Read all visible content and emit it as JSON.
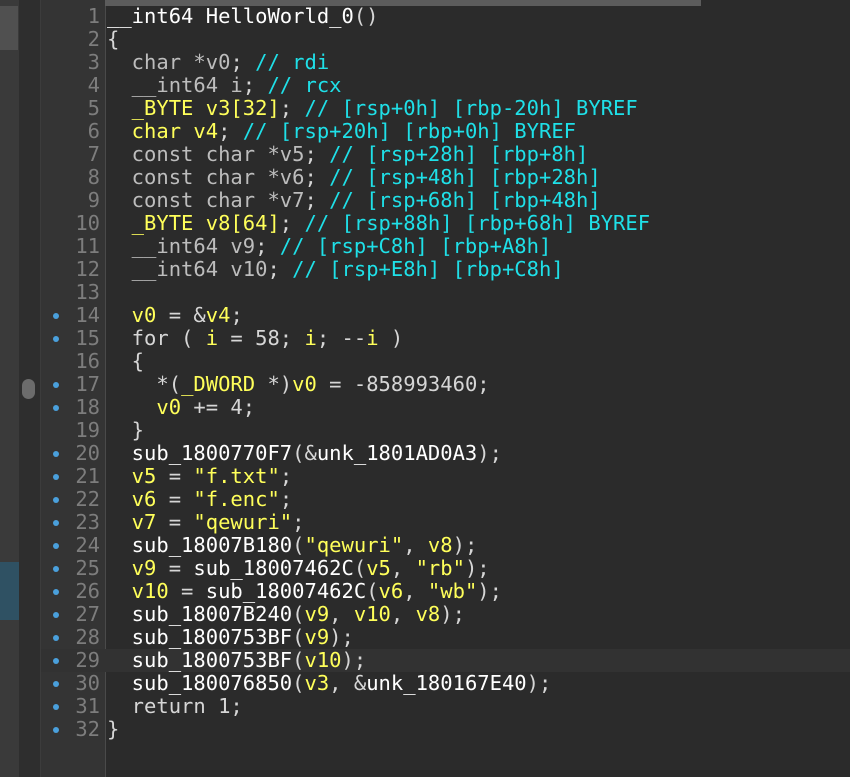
{
  "editor": {
    "lines": [
      {
        "n": "1",
        "dot": false,
        "parts": [
          [
            "__int64 HelloWorld_0",
            "t-fn"
          ],
          [
            "()",
            "t-kw"
          ]
        ]
      },
      {
        "n": "2",
        "dot": false,
        "parts": [
          [
            "{",
            "t-kw"
          ]
        ]
      },
      {
        "n": "3",
        "dot": false,
        "parts": [
          [
            "  char *",
            "t-gray"
          ],
          [
            "v0",
            "t-gray"
          ],
          [
            "; ",
            "t-kw"
          ],
          [
            "// rdi",
            "t-cmt"
          ]
        ]
      },
      {
        "n": "4",
        "dot": false,
        "parts": [
          [
            "  __int64 ",
            "t-gray"
          ],
          [
            "i",
            "t-gray"
          ],
          [
            "; ",
            "t-kw"
          ],
          [
            "// rcx",
            "t-cmt"
          ]
        ]
      },
      {
        "n": "5",
        "dot": false,
        "parts": [
          [
            "  _BYTE v3[32]",
            "t-var"
          ],
          [
            "; ",
            "t-kw"
          ],
          [
            "// [rsp+0h] [rbp-20h] BYREF",
            "t-cmt"
          ]
        ]
      },
      {
        "n": "6",
        "dot": false,
        "parts": [
          [
            "  char v4",
            "t-var"
          ],
          [
            "; ",
            "t-kw"
          ],
          [
            "// [rsp+20h] [rbp+0h] BYREF",
            "t-cmt"
          ]
        ]
      },
      {
        "n": "7",
        "dot": false,
        "parts": [
          [
            "  const char *v5",
            "t-gray"
          ],
          [
            "; ",
            "t-kw"
          ],
          [
            "// [rsp+28h] [rbp+8h]",
            "t-cmt"
          ]
        ]
      },
      {
        "n": "8",
        "dot": false,
        "parts": [
          [
            "  const char *v6",
            "t-gray"
          ],
          [
            "; ",
            "t-kw"
          ],
          [
            "// [rsp+48h] [rbp+28h]",
            "t-cmt"
          ]
        ]
      },
      {
        "n": "9",
        "dot": false,
        "parts": [
          [
            "  const char *v7",
            "t-gray"
          ],
          [
            "; ",
            "t-kw"
          ],
          [
            "// [rsp+68h] [rbp+48h]",
            "t-cmt"
          ]
        ]
      },
      {
        "n": "10",
        "dot": false,
        "parts": [
          [
            "  _BYTE v8[64]",
            "t-var"
          ],
          [
            "; ",
            "t-kw"
          ],
          [
            "// [rsp+88h] [rbp+68h] BYREF",
            "t-cmt"
          ]
        ]
      },
      {
        "n": "11",
        "dot": false,
        "parts": [
          [
            "  __int64 v9",
            "t-gray"
          ],
          [
            "; ",
            "t-kw"
          ],
          [
            "// [rsp+C8h] [rbp+A8h]",
            "t-cmt"
          ]
        ]
      },
      {
        "n": "12",
        "dot": false,
        "parts": [
          [
            "  __int64 v10",
            "t-gray"
          ],
          [
            "; ",
            "t-kw"
          ],
          [
            "// [rsp+E8h] [rbp+C8h]",
            "t-cmt"
          ]
        ]
      },
      {
        "n": "13",
        "dot": false,
        "parts": []
      },
      {
        "n": "14",
        "dot": true,
        "parts": [
          [
            "  v0",
            "t-var"
          ],
          [
            " = &",
            "t-kw"
          ],
          [
            "v4",
            "t-var"
          ],
          [
            ";",
            "t-kw"
          ]
        ]
      },
      {
        "n": "15",
        "dot": true,
        "parts": [
          [
            "  for ( ",
            "t-kw"
          ],
          [
            "i",
            "t-var"
          ],
          [
            " = 58; ",
            "t-kw"
          ],
          [
            "i",
            "t-var"
          ],
          [
            "; --",
            "t-kw"
          ],
          [
            "i",
            "t-var"
          ],
          [
            " )",
            "t-kw"
          ]
        ]
      },
      {
        "n": "16",
        "dot": false,
        "parts": [
          [
            "  {",
            "t-kw"
          ]
        ]
      },
      {
        "n": "17",
        "dot": true,
        "parts": [
          [
            "    *(",
            "t-kw"
          ],
          [
            "_DWORD",
            "t-var"
          ],
          [
            " *)",
            "t-kw"
          ],
          [
            "v0",
            "t-var"
          ],
          [
            " = -858993460;",
            "t-kw"
          ]
        ]
      },
      {
        "n": "18",
        "dot": true,
        "parts": [
          [
            "    v0",
            "t-var"
          ],
          [
            " += 4;",
            "t-kw"
          ]
        ]
      },
      {
        "n": "19",
        "dot": false,
        "parts": [
          [
            "  }",
            "t-kw"
          ]
        ]
      },
      {
        "n": "20",
        "dot": true,
        "parts": [
          [
            "  sub_1800770F7",
            "t-fn"
          ],
          [
            "(&",
            "t-kw"
          ],
          [
            "unk_1801AD0A3",
            "t-fn"
          ],
          [
            ");",
            "t-kw"
          ]
        ]
      },
      {
        "n": "21",
        "dot": true,
        "parts": [
          [
            "  v5",
            "t-var"
          ],
          [
            " = ",
            "t-kw"
          ],
          [
            "\"f.txt\"",
            "t-str"
          ],
          [
            ";",
            "t-kw"
          ]
        ]
      },
      {
        "n": "22",
        "dot": true,
        "parts": [
          [
            "  v6",
            "t-var"
          ],
          [
            " = ",
            "t-kw"
          ],
          [
            "\"f.enc\"",
            "t-str"
          ],
          [
            ";",
            "t-kw"
          ]
        ]
      },
      {
        "n": "23",
        "dot": true,
        "parts": [
          [
            "  v7",
            "t-var"
          ],
          [
            " = ",
            "t-kw"
          ],
          [
            "\"qewuri\"",
            "t-str"
          ],
          [
            ";",
            "t-kw"
          ]
        ]
      },
      {
        "n": "24",
        "dot": true,
        "parts": [
          [
            "  sub_18007B180",
            "t-fn"
          ],
          [
            "(",
            "t-kw"
          ],
          [
            "\"qewuri\"",
            "t-str"
          ],
          [
            ", ",
            "t-kw"
          ],
          [
            "v8",
            "t-var"
          ],
          [
            ");",
            "t-kw"
          ]
        ]
      },
      {
        "n": "25",
        "dot": true,
        "parts": [
          [
            "  v9",
            "t-var"
          ],
          [
            " = ",
            "t-kw"
          ],
          [
            "sub_18007462C",
            "t-fn"
          ],
          [
            "(",
            "t-kw"
          ],
          [
            "v5",
            "t-var"
          ],
          [
            ", ",
            "t-kw"
          ],
          [
            "\"rb\"",
            "t-str"
          ],
          [
            ");",
            "t-kw"
          ]
        ]
      },
      {
        "n": "26",
        "dot": true,
        "parts": [
          [
            "  v10",
            "t-var"
          ],
          [
            " = ",
            "t-kw"
          ],
          [
            "sub_18007462C",
            "t-fn"
          ],
          [
            "(",
            "t-kw"
          ],
          [
            "v6",
            "t-var"
          ],
          [
            ", ",
            "t-kw"
          ],
          [
            "\"wb\"",
            "t-str"
          ],
          [
            ");",
            "t-kw"
          ]
        ]
      },
      {
        "n": "27",
        "dot": true,
        "parts": [
          [
            "  sub_18007B240",
            "t-fn"
          ],
          [
            "(",
            "t-kw"
          ],
          [
            "v9",
            "t-var"
          ],
          [
            ", ",
            "t-kw"
          ],
          [
            "v10",
            "t-var"
          ],
          [
            ", ",
            "t-kw"
          ],
          [
            "v8",
            "t-var"
          ],
          [
            ");",
            "t-kw"
          ]
        ]
      },
      {
        "n": "28",
        "dot": true,
        "parts": [
          [
            "  sub_1800753BF",
            "t-fn"
          ],
          [
            "(",
            "t-kw"
          ],
          [
            "v9",
            "t-var"
          ],
          [
            ");",
            "t-kw"
          ]
        ]
      },
      {
        "n": "29",
        "dot": true,
        "hl": true,
        "parts": [
          [
            "  sub_1800753BF",
            "t-fn"
          ],
          [
            "(",
            "t-kw"
          ],
          [
            "v10",
            "t-var"
          ],
          [
            ");",
            "t-kw"
          ]
        ]
      },
      {
        "n": "30",
        "dot": true,
        "parts": [
          [
            "  sub_180076850",
            "t-fn"
          ],
          [
            "(",
            "t-kw"
          ],
          [
            "v3",
            "t-var"
          ],
          [
            ", &",
            "t-kw"
          ],
          [
            "unk_180167E40",
            "t-fn"
          ],
          [
            ");",
            "t-kw"
          ]
        ]
      },
      {
        "n": "31",
        "dot": true,
        "parts": [
          [
            "  return 1;",
            "t-kw"
          ]
        ]
      },
      {
        "n": "32",
        "dot": true,
        "parts": [
          [
            "}",
            "t-kw"
          ]
        ]
      }
    ]
  }
}
